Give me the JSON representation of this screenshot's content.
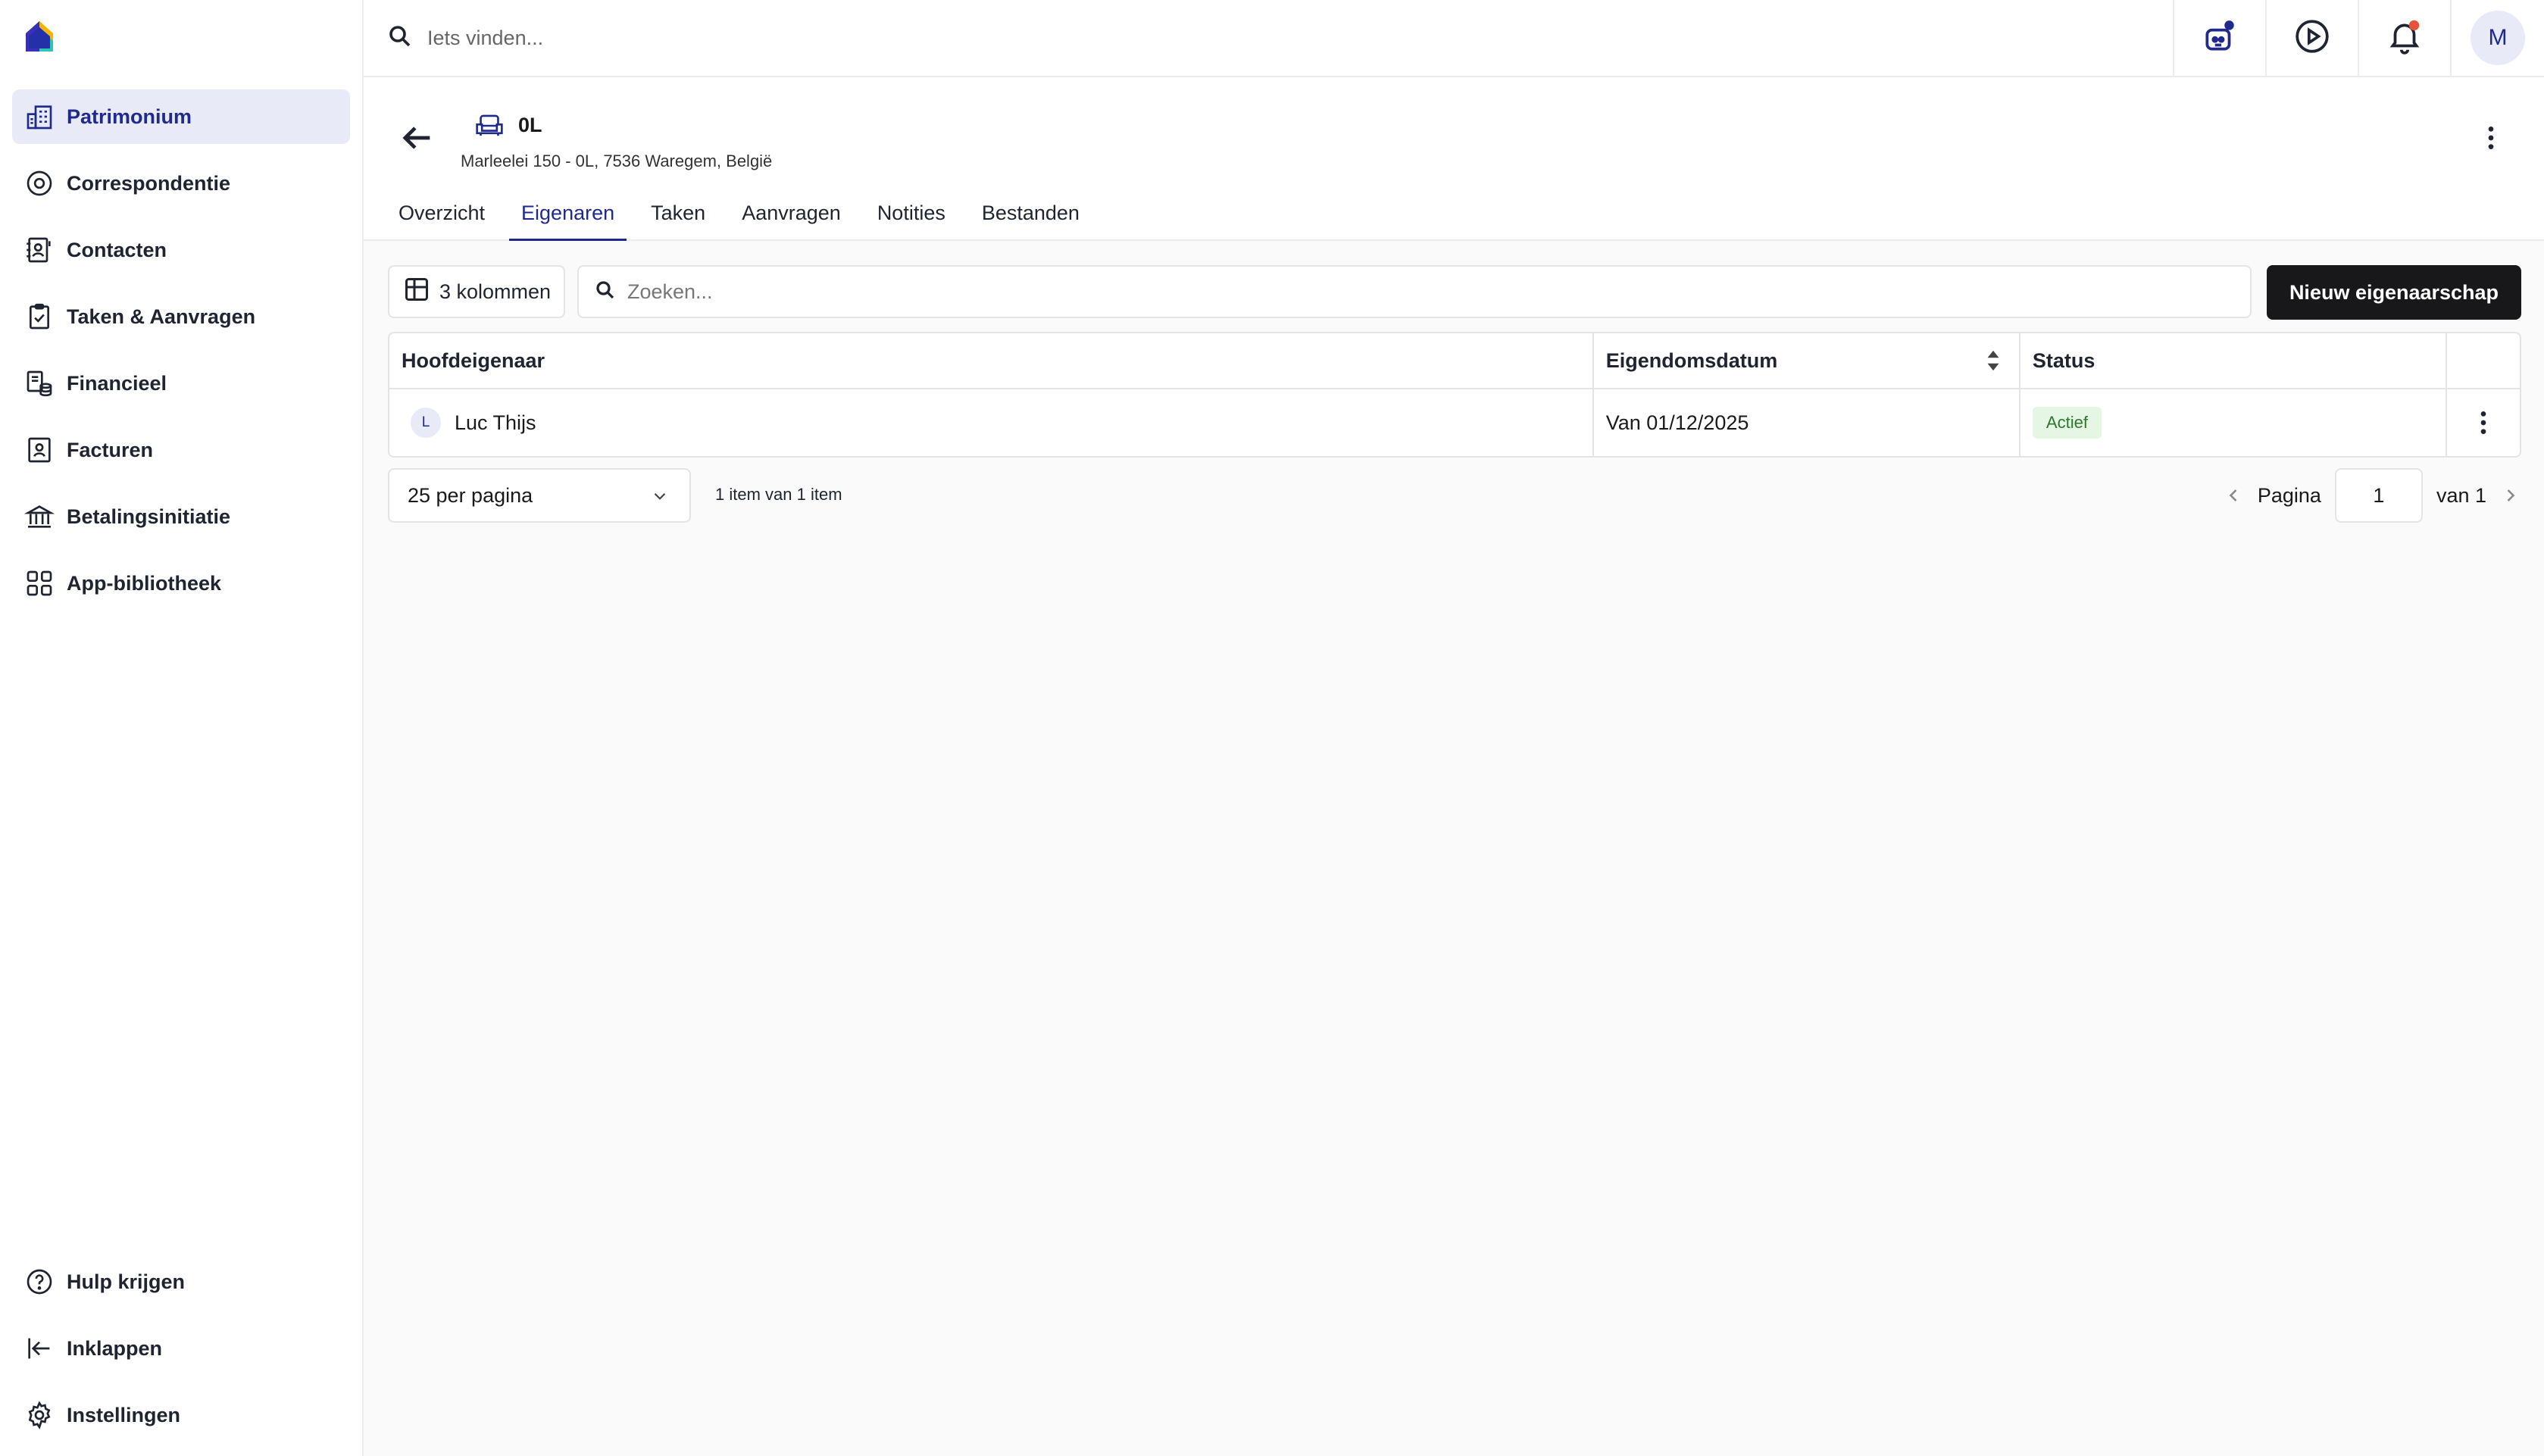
{
  "app": {
    "brand_colors": {
      "accent": "#1f2a8c",
      "active_bg": "#e8eaf8",
      "primary_button": "#18181b",
      "badge_bg": "#e5f6e5",
      "badge_text": "#2a7a2a",
      "notification_dot": "#e5533d"
    }
  },
  "sidebar": {
    "items": [
      {
        "label": "Patrimonium",
        "icon": "buildings-icon",
        "active": true
      },
      {
        "label": "Correspondentie",
        "icon": "correspondence-icon"
      },
      {
        "label": "Contacten",
        "icon": "contacts-book-icon"
      },
      {
        "label": "Taken & Aanvragen",
        "icon": "clipboard-check-icon"
      },
      {
        "label": "Financieel",
        "icon": "coins-icon"
      },
      {
        "label": "Facturen",
        "icon": "invoice-icon"
      },
      {
        "label": "Betalingsinitiatie",
        "icon": "bank-icon"
      },
      {
        "label": "App-bibliotheek",
        "icon": "app-grid-icon"
      }
    ],
    "bottom": [
      {
        "label": "Hulp krijgen",
        "icon": "help-circle-icon"
      },
      {
        "label": "Inklappen",
        "icon": "collapse-left-icon"
      },
      {
        "label": "Instellingen",
        "icon": "gear-icon"
      }
    ]
  },
  "topbar": {
    "search_placeholder": "Iets vinden...",
    "avatar_initial": "M"
  },
  "header": {
    "unit_name": "0L",
    "address": "Marleelei 150 - 0L, 7536 Waregem, België",
    "tabs": [
      {
        "label": "Overzicht"
      },
      {
        "label": "Eigenaren",
        "active": true
      },
      {
        "label": "Taken"
      },
      {
        "label": "Aanvragen"
      },
      {
        "label": "Notities"
      },
      {
        "label": "Bestanden"
      }
    ]
  },
  "toolbar": {
    "columns_label": "3 kolommen",
    "search_placeholder": "Zoeken...",
    "new_button": "Nieuw eigenaarschap"
  },
  "table": {
    "columns": [
      "Hoofdeigenaar",
      "Eigendomsdatum",
      "Status"
    ],
    "rows": [
      {
        "avatar": "L",
        "owner": "Luc Thijs",
        "date": "Van 01/12/2025",
        "status": "Actief"
      }
    ]
  },
  "pagination": {
    "per_page": "25 per pagina",
    "count": "1 item van 1 item",
    "page_label": "Pagina",
    "current_page": "1",
    "of_label": "van 1"
  }
}
